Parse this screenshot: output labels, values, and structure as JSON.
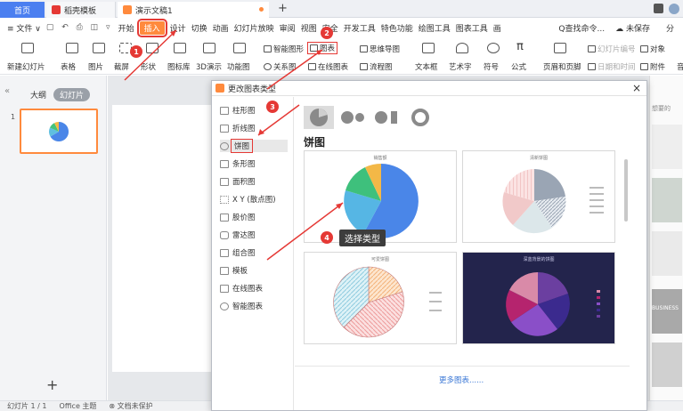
{
  "tabs": {
    "home": "首页",
    "template": "稻壳模板",
    "document": "演示文稿1",
    "add": "+"
  },
  "menu": {
    "file": "≡ 文件 ∨",
    "start": "开始",
    "insert": "插入",
    "items": [
      "设计",
      "切换",
      "动画",
      "幻灯片放映",
      "审阅",
      "视图",
      "安全",
      "开发工具",
      "特色功能",
      "绘图工具",
      "图表工具",
      "画"
    ],
    "search": "Q查找命令...",
    "unsaved": "未保存",
    "share": "分"
  },
  "ribbon": {
    "new_slide": "新建幻灯片",
    "table": "表格",
    "picture": "图片",
    "screenshot": "截屏",
    "shape": "形状",
    "icon_lib": "图标库",
    "three_d": "3D演示",
    "function_chart": "功能图",
    "smart_shape": "智能图形",
    "chart": "图表",
    "mind_map": "思维导图",
    "relation": "关系图",
    "online_chart": "在线图表",
    "flowchart": "流程图",
    "textbox": "文本框",
    "art_text": "艺术字",
    "symbol": "符号",
    "formula": "公式",
    "header_footer": "页眉和页脚",
    "slide_number": "幻灯片编号",
    "date_time": "日期和时间",
    "object": "对象",
    "attachment": "附件",
    "more": "音"
  },
  "sidebar": {
    "outline": "大纲",
    "slides": "幻灯片",
    "slide_number": "1",
    "add": "+"
  },
  "statusbar": {
    "slide": "幻灯片 1 / 1",
    "theme": "Office 主题",
    "protect": "文档未保护"
  },
  "right_panel": {
    "label": "想要的",
    "business": "BUSINESS"
  },
  "dialog": {
    "title": "更改图表类型",
    "close": "×",
    "categories": [
      "柱形图",
      "折线图",
      "饼图",
      "条形图",
      "面积图",
      "X Y (散点图)",
      "股价图",
      "雷达图",
      "组合图",
      "模板",
      "在线图表",
      "智能图表"
    ],
    "selected_category": "饼图",
    "section_title": "饼图",
    "previews": [
      {
        "title": "销售额",
        "style": "basic"
      },
      {
        "title": "清新饼图",
        "style": "pattern"
      },
      {
        "title": "可爱饼图",
        "style": "cute"
      },
      {
        "title": "深蓝背景的饼图",
        "style": "dark"
      }
    ],
    "more_charts": "更多图表......"
  },
  "annotations": {
    "step1": "1",
    "step2": "2",
    "step3": "3",
    "step4": "4",
    "tooltip": "选择类型"
  },
  "colors": {
    "accent_orange": "#ff8a3d",
    "accent_blue": "#4b7ff0",
    "annotation_red": "#e53935"
  }
}
